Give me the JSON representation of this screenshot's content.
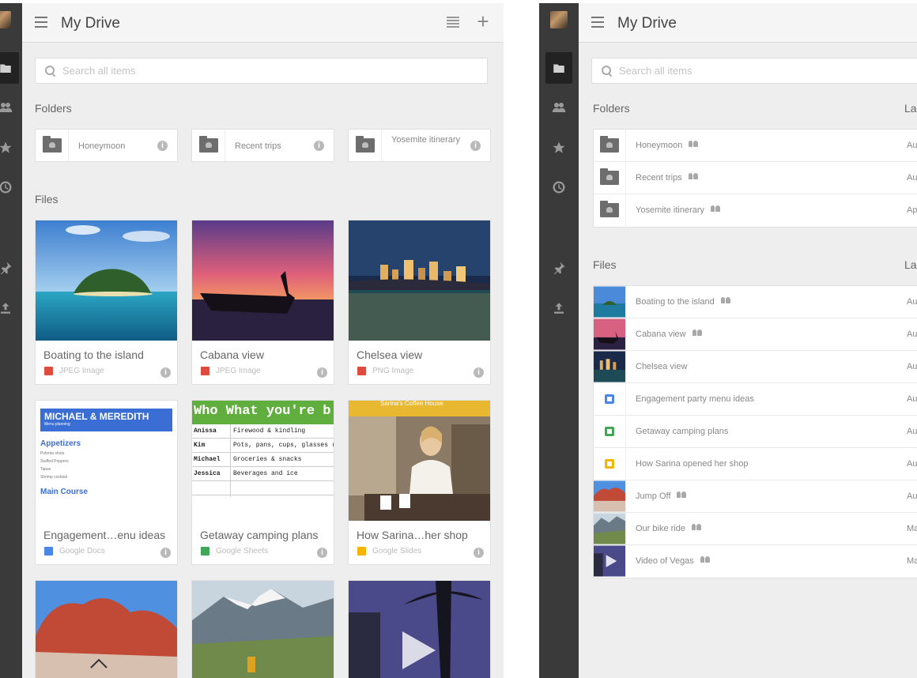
{
  "screenA": {
    "title": "My Drive",
    "search_placeholder": "Search all items",
    "folders_label": "Folders",
    "files_label": "Files",
    "folders": [
      {
        "name": "Honeymoon"
      },
      {
        "name": "Recent trips"
      },
      {
        "name": "Yosemite itinerary"
      }
    ],
    "files": [
      {
        "name": "Boating to the island",
        "type": "JPEG Image",
        "type_color": "#e04a3f"
      },
      {
        "name": "Cabana view",
        "type": "JPEG Image",
        "type_color": "#e04a3f"
      },
      {
        "name": "Chelsea view",
        "type": "PNG Image",
        "type_color": "#e04a3f"
      },
      {
        "name": "Engagement…enu ideas",
        "type": "Google Docs",
        "type_color": "#4a86e8"
      },
      {
        "name": "Getaway camping plans",
        "type": "Google Sheets",
        "type_color": "#3fa757"
      },
      {
        "name": "How Sarina…her shop",
        "type": "Google Slides",
        "type_color": "#f4b400"
      }
    ],
    "doc_thumb": {
      "header": "MICHAEL & MEREDITH",
      "subheader": "Menu planning",
      "section1": "Appetizers",
      "lines1": [
        "Polenta shots",
        "Stuffed Peppers",
        "Tapas",
        "Shrimp cocktail"
      ],
      "section2": "Main Course"
    },
    "sheet_thumb": {
      "header": "Who  What you're b",
      "rows": [
        {
          "who": "Anissa",
          "what": "Firewood & kindling"
        },
        {
          "who": "Kim",
          "what": "Pots, pans, cups, glasses (pape"
        },
        {
          "who": "Michael",
          "what": "Groceries & snacks"
        },
        {
          "who": "Jessica",
          "what": "Beverages and ice"
        }
      ]
    },
    "slides_thumb": {
      "sign": "Sarina's Coffee House"
    }
  },
  "screenB": {
    "title": "My Drive",
    "search_placeholder": "Search all items",
    "folders_label": "Folders",
    "files_label": "Files",
    "column_header": "La",
    "folders": [
      {
        "name": "Honeymoon",
        "date": "Au"
      },
      {
        "name": "Recent trips",
        "date": "Au"
      },
      {
        "name": "Yosemite itinerary",
        "date": "Ap"
      }
    ],
    "files": [
      {
        "name": "Boating to the island",
        "date": "Au",
        "shared": true,
        "thumb": "island"
      },
      {
        "name": "Cabana view",
        "date": "Au",
        "shared": true,
        "thumb": "sunset"
      },
      {
        "name": "Chelsea view",
        "date": "Au",
        "shared": false,
        "thumb": "city"
      },
      {
        "name": "Engagement party menu ideas",
        "date": "Au",
        "shared": false,
        "thumb": "docs"
      },
      {
        "name": "Getaway camping plans",
        "date": "Au",
        "shared": false,
        "thumb": "sheets"
      },
      {
        "name": "How Sarina opened her shop",
        "date": "Au",
        "shared": false,
        "thumb": "slides"
      },
      {
        "name": "Jump Off",
        "date": "Au",
        "shared": true,
        "thumb": "canyon"
      },
      {
        "name": "Our bike ride",
        "date": "Ma",
        "shared": true,
        "thumb": "mountain"
      },
      {
        "name": "Video of Vegas",
        "date": "Ma",
        "shared": true,
        "thumb": "vegas"
      }
    ]
  },
  "colors": {
    "rail": "#3a3a3a",
    "content_bg": "#eeeeee",
    "docs": "#4a86e8",
    "sheets": "#3fa757",
    "slides": "#f4b400",
    "image": "#e04a3f"
  }
}
